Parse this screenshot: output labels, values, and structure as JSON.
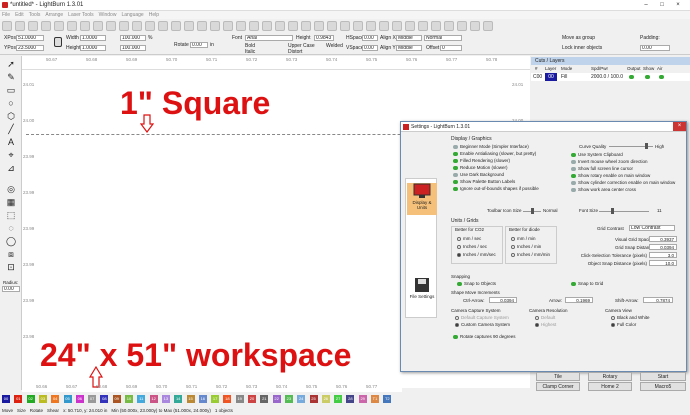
{
  "window": {
    "title": "*untitled* - LightBurn 1.3.01"
  },
  "menu": [
    "File",
    "Edit",
    "Tools",
    "Arrange",
    "Laser Tools",
    "Window",
    "Language",
    "Help"
  ],
  "props": {
    "xpos_label": "XPos",
    "xpos": "51.0000",
    "ypos_label": "YPos",
    "ypos": "23.5000",
    "width_label": "Width",
    "width": "1.0000",
    "height_label": "Height",
    "height": "1.0000",
    "percent_1": "100.000",
    "percent_2": "100.000",
    "pct": "%",
    "rotate_label": "Rotate",
    "rotate": "0.00",
    "rotate_unit": "in",
    "font_label": "Font",
    "font": "Arial",
    "height2_label": "Height",
    "height2": "0.9843",
    "hspace_label": "HSpace",
    "hspace": "0.00",
    "align_x_label": "Align X",
    "align_x": "Middle",
    "vspace_label": "VSpace",
    "vspace": "0.00",
    "align_y_label": "Align Y",
    "align_y": "Middle",
    "normal": "Normal",
    "offset_label": "Offset",
    "offset": "0",
    "bold": "Bold",
    "italic": "Italic",
    "upper_case": "Upper Case",
    "welded": "Welded",
    "distort": "Distort",
    "move_as_group": "Move as group",
    "lock_inner": "Lock inner objects",
    "padding_label": "Padding:",
    "padding": "0.00"
  },
  "ruler": {
    "top": [
      "50.67",
      "50.68",
      "50.69",
      "50.70",
      "50.71",
      "50.72",
      "50.73",
      "50.74",
      "50.75",
      "50.76",
      "50.77",
      "50.78"
    ],
    "left": [
      "24.01",
      "24.00",
      "23.99",
      "23.99",
      "23.99",
      "23.99",
      "23.99",
      "23.98"
    ],
    "right": [
      "24.01",
      "24.00",
      "23.99",
      "23.99",
      "23.99",
      "23.99",
      "23.99",
      "23.98"
    ],
    "bottom": [
      "50.66",
      "50.67",
      "50.68",
      "50.69",
      "50.70",
      "50.71",
      "50.72",
      "50.73",
      "50.74",
      "50.75",
      "50.76",
      "50.77"
    ]
  },
  "annotations": {
    "top": "1\" Square",
    "bottom": "24\" x 51\" workspace"
  },
  "left_tools": {
    "radius_label": "Radius:",
    "radius": "0.00"
  },
  "layers": {
    "title": "Cuts / Layers",
    "cols": [
      "#",
      "Layer",
      "Mode",
      "Spd/Pwr",
      "Output",
      "Show",
      "Air"
    ],
    "row": {
      "num": "C00",
      "layer": "00",
      "mode": "Fill",
      "spdpwr": "2000.0 / 100.0"
    }
  },
  "settings": {
    "title": "Settings - LightBurn 1.3.01",
    "side": [
      {
        "label": "Display & Units"
      },
      {
        "label": "File Settings"
      }
    ],
    "display_graphics": "Display / Graphics",
    "left_opts": [
      "Beginner Mode (Simpler Interface)",
      "Enable Antialiasing (slower, but pretty)",
      "Filled Rendering (slower)",
      "Reduce Motion (slower)",
      "Use Dark Background",
      "Show Palette Button Labels",
      "Ignore out-of-bounds shapes if possible"
    ],
    "left_on": [
      false,
      true,
      true,
      true,
      false,
      true,
      true
    ],
    "curve_quality": "Curve Quality",
    "high": "High",
    "right_opts": [
      "Use System Clipboard",
      "Invert mouse wheel zoom direction",
      "Show full screen line cursor",
      "Show rotary enable on main window",
      "Show cylinder correction enable on main window",
      "Show work area center cross"
    ],
    "right_on": [
      true,
      false,
      false,
      true,
      false,
      false
    ],
    "toolbar_icon_size": "Toolbar Icon Size",
    "normal": "Normal",
    "font_size": "Font Size",
    "font_size_val": "11",
    "units_grids": "Units / Grids",
    "better_co2": "Better for CO2",
    "co2_units": [
      "mm / sec",
      "Inches / sec",
      "Inches / mm/sec"
    ],
    "better_diode": "Better for diode",
    "diode_units": [
      "mm / min",
      "Inches / min",
      "Inches / mm/min"
    ],
    "grid_contrast": "Grid Contrast",
    "grid_contrast_val": "Low Contrast",
    "grid_fields": [
      {
        "label": "Visual Grid Spacing",
        "value": "0.3937"
      },
      {
        "label": "Grid Snap Distance",
        "value": "0.0394"
      },
      {
        "label": "Click-Selection Tolerance (pixels)",
        "value": "3.0"
      },
      {
        "label": "Object Snap Distance (pixels)",
        "value": "10.0"
      }
    ],
    "snapping": "Snapping",
    "snap_objects": "Snap to Objects",
    "snap_grid": "Snap to Grid",
    "shape_move": "Shape Move Increments",
    "ctrl_arrow": "Ctrl-Arrow:",
    "ctrl_val": "0.0394",
    "arrow": "Arrow:",
    "arrow_val": "0.1969",
    "shift_arrow": "Shift-Arrow:",
    "shift_val": "0.7874",
    "camera_capture": "Camera Capture System",
    "default_capture": "Default Capture System",
    "custom_capture": "Custom Camera System",
    "camera_resolution": "Camera Resolution",
    "res_default": "Default",
    "res_highest": "Highest",
    "camera_view": "Camera View",
    "black_white": "Black and White",
    "full_color": "Full Color",
    "rotate_captures": "Rotate captures 90 degrees"
  },
  "bottom_buttons": [
    "Tile",
    "Rotary",
    "Start",
    "Clamp Corner",
    "Home 2",
    "Macro5"
  ],
  "swatches": [
    {
      "label": "00",
      "color": "#1a1aa0"
    },
    {
      "label": "01",
      "color": "#d21"
    },
    {
      "label": "02",
      "color": "#2a2"
    },
    {
      "label": "03",
      "color": "#bb2"
    },
    {
      "label": "04",
      "color": "#e72"
    },
    {
      "label": "05",
      "color": "#39c"
    },
    {
      "label": "06",
      "color": "#c3c"
    },
    {
      "label": "07",
      "color": "#999"
    },
    {
      "label": "08",
      "color": "#33b"
    },
    {
      "label": "09",
      "color": "#a52"
    },
    {
      "label": "10",
      "color": "#7b4"
    },
    {
      "label": "11",
      "color": "#4ad"
    },
    {
      "label": "12",
      "color": "#c58"
    },
    {
      "label": "13",
      "color": "#a8d"
    },
    {
      "label": "14",
      "color": "#3a9"
    },
    {
      "label": "15",
      "color": "#b83"
    },
    {
      "label": "16",
      "color": "#68c"
    },
    {
      "label": "17",
      "color": "#9c3"
    },
    {
      "label": "18",
      "color": "#e52"
    },
    {
      "label": "19",
      "color": "#888"
    },
    {
      "label": "20",
      "color": "#c44"
    },
    {
      "label": "21",
      "color": "#666"
    },
    {
      "label": "22",
      "color": "#96c"
    },
    {
      "label": "23",
      "color": "#5b5"
    },
    {
      "label": "24",
      "color": "#7ad"
    },
    {
      "label": "25",
      "color": "#a33"
    },
    {
      "label": "26",
      "color": "#cc6"
    },
    {
      "label": "27",
      "color": "#4c4"
    },
    {
      "label": "28",
      "color": "#448"
    },
    {
      "label": "29",
      "color": "#c6a"
    },
    {
      "label": "T1",
      "color": "#d84"
    },
    {
      "label": "T2",
      "color": "#47b"
    }
  ],
  "status": {
    "move": "Move",
    "size": "Size",
    "rotate": "Rotate",
    "shear": "Shear",
    "coords": "x: 50.710, y: 24.010 in",
    "minmax": "Min (50.000x, 23.000y) to Max (51.000x, 24.000y)",
    "objects": "1 objects"
  }
}
